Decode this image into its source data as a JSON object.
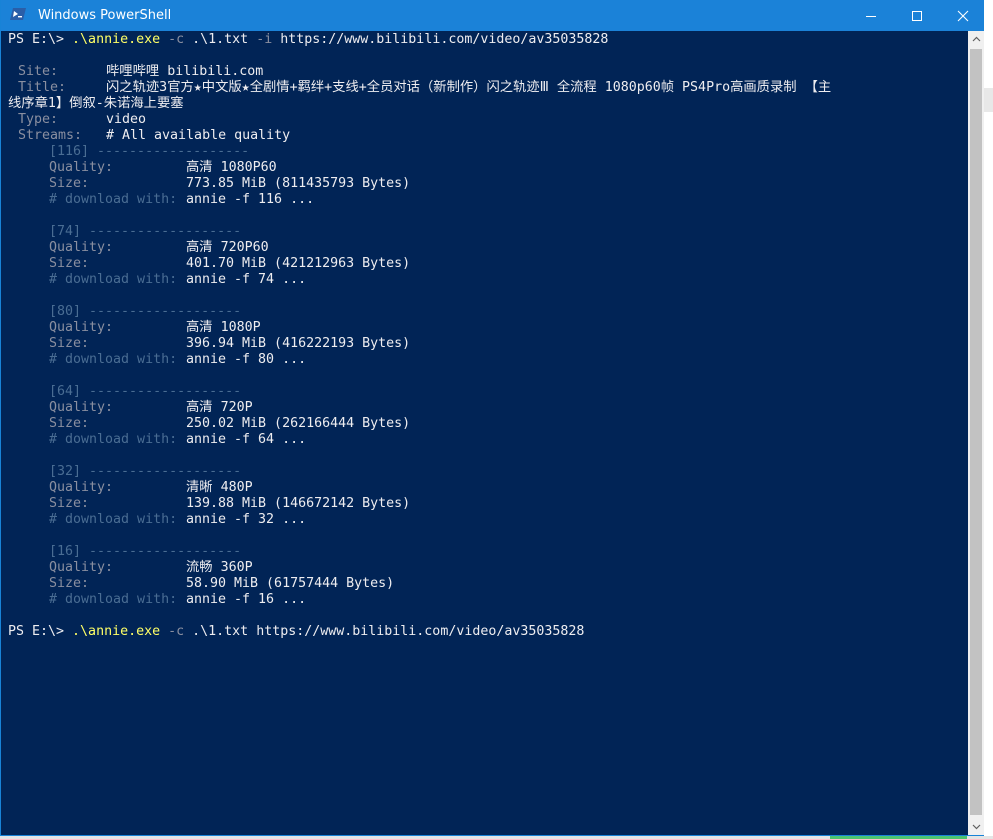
{
  "window": {
    "title": "Windows PowerShell",
    "icon": "powershell-icon",
    "controls": [
      "minimize-icon",
      "maximize-icon",
      "close-icon"
    ]
  },
  "colors": {
    "console_background": "#012456",
    "titlebar": "#1b82d8",
    "label_gray": "#8a8fa0",
    "dim_blue": "#4a6d93",
    "command_yellow": "#ffff66",
    "text": "#eeedf0"
  },
  "console": {
    "command1": {
      "prompt": "PS E:\\> ",
      "exe": ".\\annie.exe",
      "flag1": " -c ",
      "arg1": ".\\1.txt",
      "flag2": " -i ",
      "url": "https://www.bilibili.com/video/av35035828"
    },
    "info": {
      "site_label": "Site:",
      "site_value": "哔哩哔哩 bilibili.com",
      "title_label": "Title:",
      "title_value_line1": "闪之轨迹3官方★中文版★全剧情+羁绊+支线+全员对话（新制作）闪之轨迹Ⅲ 全流程 1080p60帧 PS4Pro高画质录制 【主",
      "title_value_line2": "线序章1】倒叙-朱诺海上要塞",
      "type_label": "Type:",
      "type_value": "video",
      "streams_label": "Streams:",
      "streams_value": "# All available quality"
    },
    "labels": {
      "quality": "Quality:",
      "size": "Size:",
      "download": "# download with:"
    },
    "streams": [
      {
        "id": "[116] -------------------",
        "quality": "高清 1080P60",
        "size": "773.85 MiB (811435793 Bytes)",
        "download": "annie -f 116 ..."
      },
      {
        "id": "[74] -------------------",
        "quality": "高清 720P60",
        "size": "401.70 MiB (421212963 Bytes)",
        "download": "annie -f 74 ..."
      },
      {
        "id": "[80] -------------------",
        "quality": "高清 1080P",
        "size": "396.94 MiB (416222193 Bytes)",
        "download": "annie -f 80 ..."
      },
      {
        "id": "[64] -------------------",
        "quality": "高清 720P",
        "size": "250.02 MiB (262166444 Bytes)",
        "download": "annie -f 64 ..."
      },
      {
        "id": "[32] -------------------",
        "quality": "清晰 480P",
        "size": "139.88 MiB (146672142 Bytes)",
        "download": "annie -f 32 ..."
      },
      {
        "id": "[16] -------------------",
        "quality": "流畅 360P",
        "size": "58.90 MiB (61757444 Bytes)",
        "download": "annie -f 16 ..."
      }
    ],
    "command2": {
      "prompt": "PS E:\\> ",
      "exe": ".\\annie.exe",
      "flag1": " -c ",
      "arg1": ".\\1.txt",
      "url": " https://www.bilibili.com/video/av35035828"
    }
  }
}
